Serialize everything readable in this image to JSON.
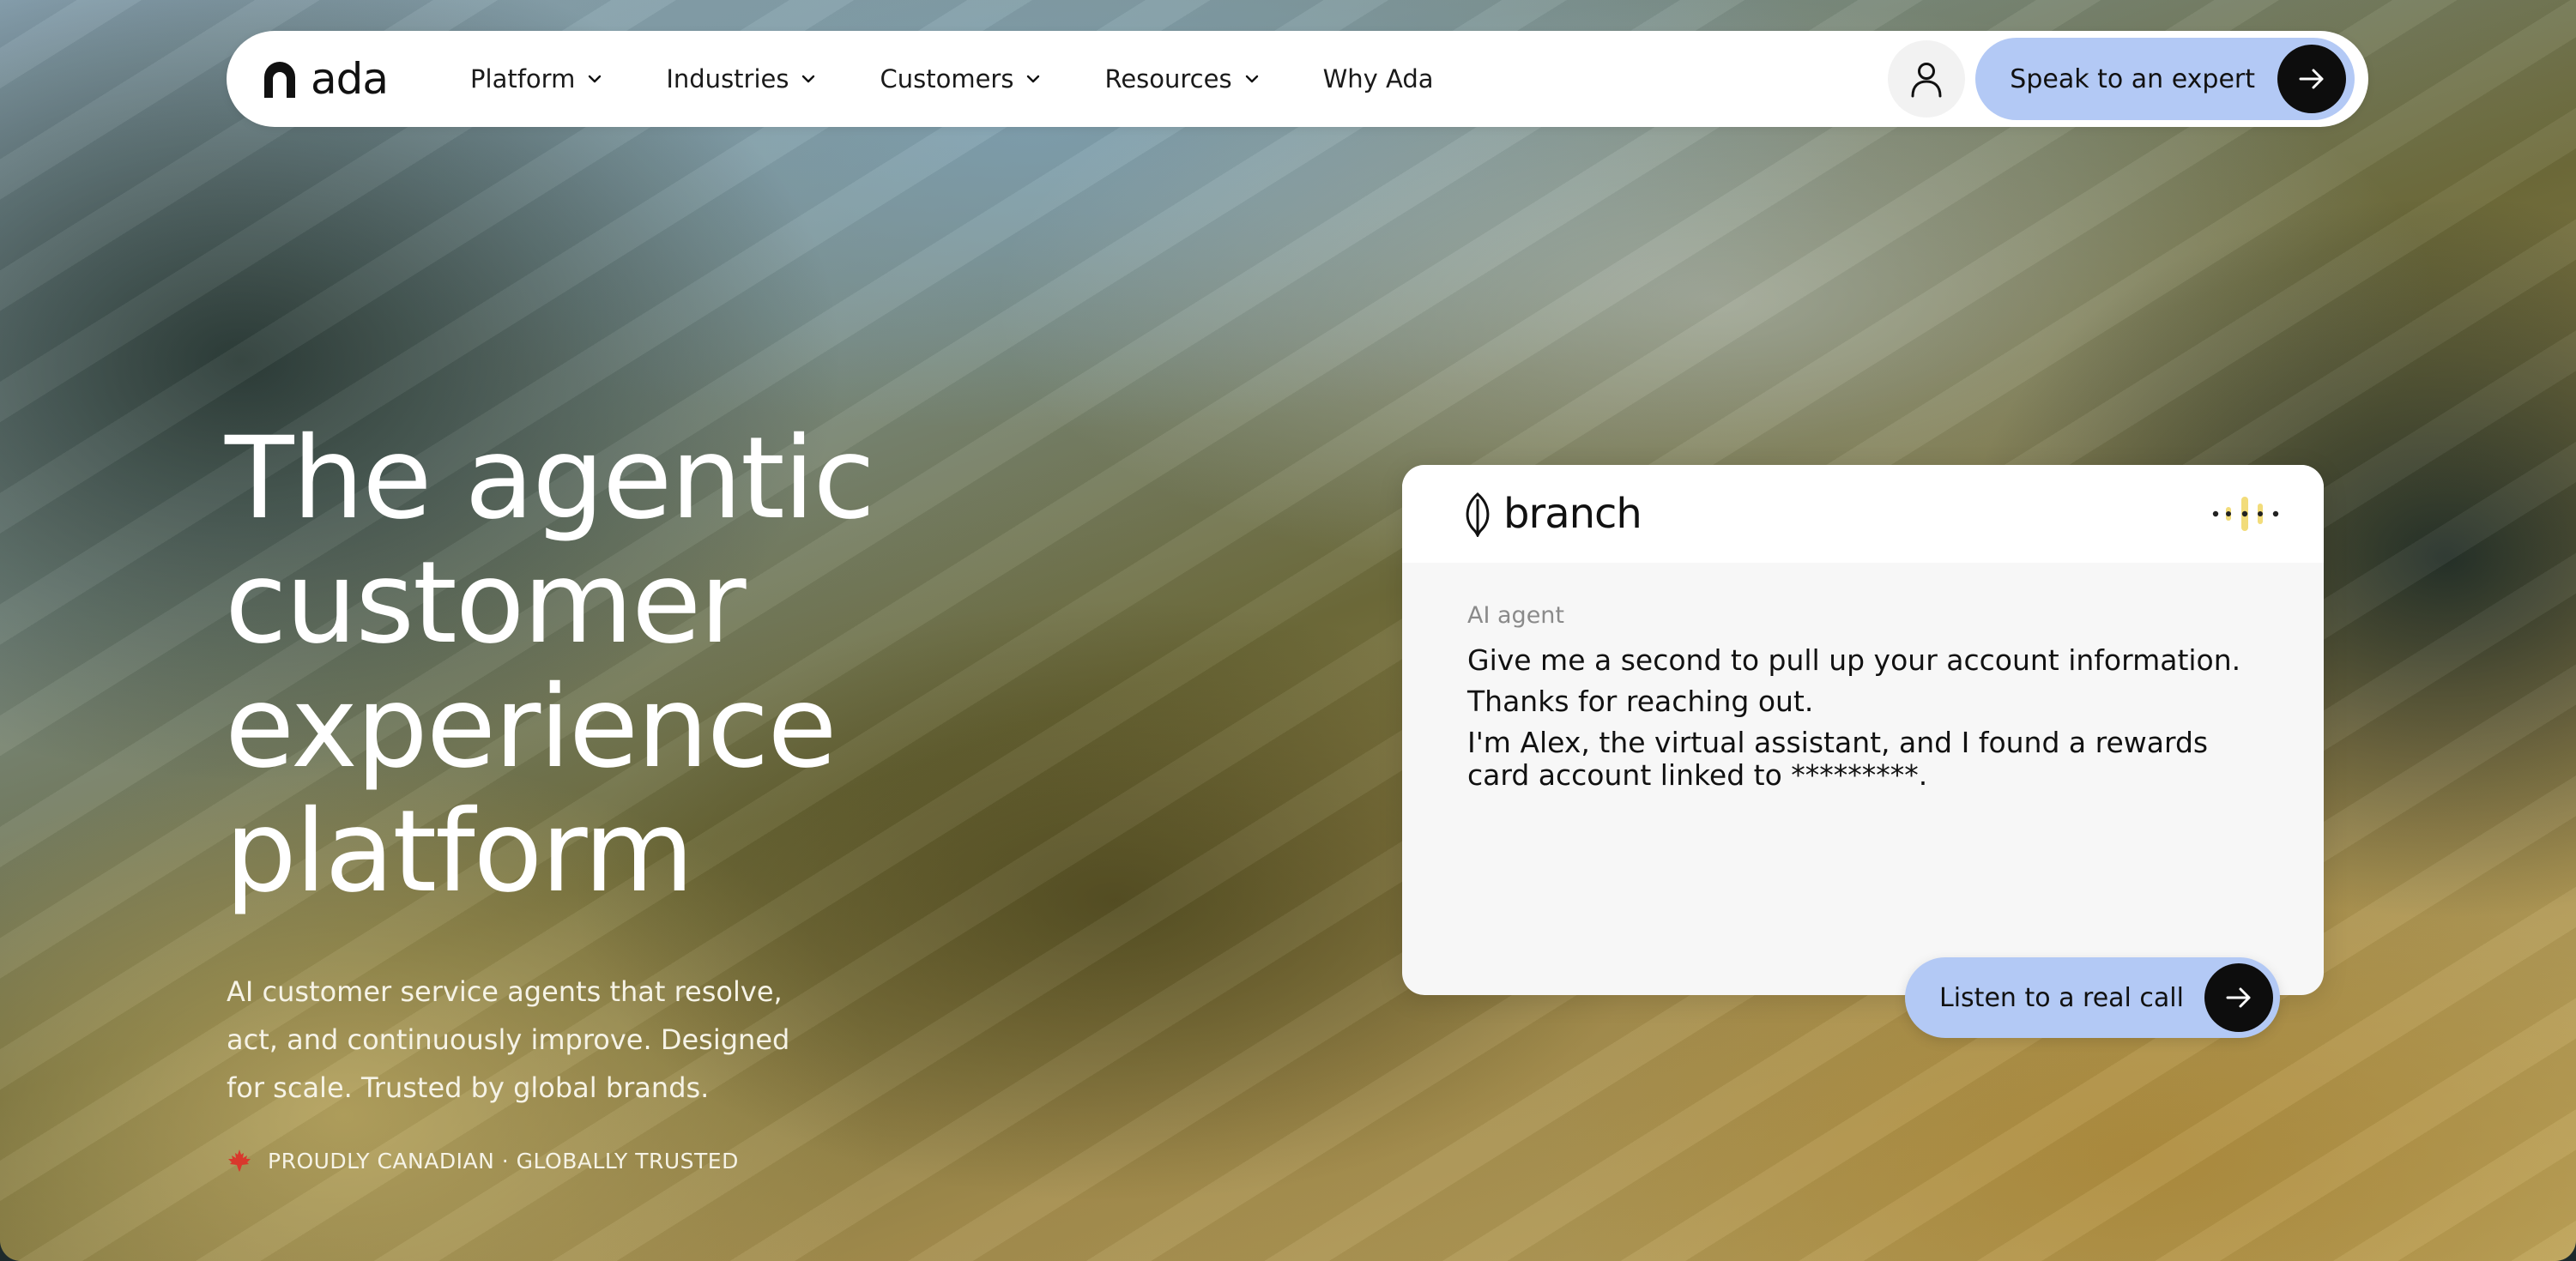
{
  "nav": {
    "logo_text": "ada",
    "menu": [
      {
        "label": "Platform",
        "has_dropdown": true
      },
      {
        "label": "Industries",
        "has_dropdown": true
      },
      {
        "label": "Customers",
        "has_dropdown": true
      },
      {
        "label": "Resources",
        "has_dropdown": true
      },
      {
        "label": "Why Ada",
        "has_dropdown": false
      }
    ],
    "cta_label": "Speak to an expert"
  },
  "hero": {
    "headline_lines": [
      "The agentic",
      "customer",
      "experience",
      "platform"
    ],
    "subtext": "AI customer service agents that resolve, act, and continuously improve. Designed for scale. Trusted by global brands.",
    "badge": "PROUDLY CANADIAN · GLOBALLY TRUSTED"
  },
  "chat_card": {
    "brand": "branch",
    "sender": "AI agent",
    "messages": [
      "Give me a second to pull up your account information.",
      "Thanks for reaching out.",
      "I'm Alex, the virtual assistant, and I found a rewards card account linked to *********."
    ],
    "listen_label": "Listen to a real call"
  },
  "colors": {
    "cta_background": "#b3c9f5",
    "arrow_button": "#0d0d0d",
    "maple_leaf": "#d9382c",
    "wave_accent": "#f2dc7a"
  },
  "icons": {
    "logo": "ada-logo-icon",
    "chevron": "chevron-down-icon",
    "user": "user-icon",
    "arrow": "arrow-right-icon",
    "maple": "maple-leaf-icon",
    "brand": "branch-leaf-icon",
    "voice": "voice-wave-icon"
  }
}
